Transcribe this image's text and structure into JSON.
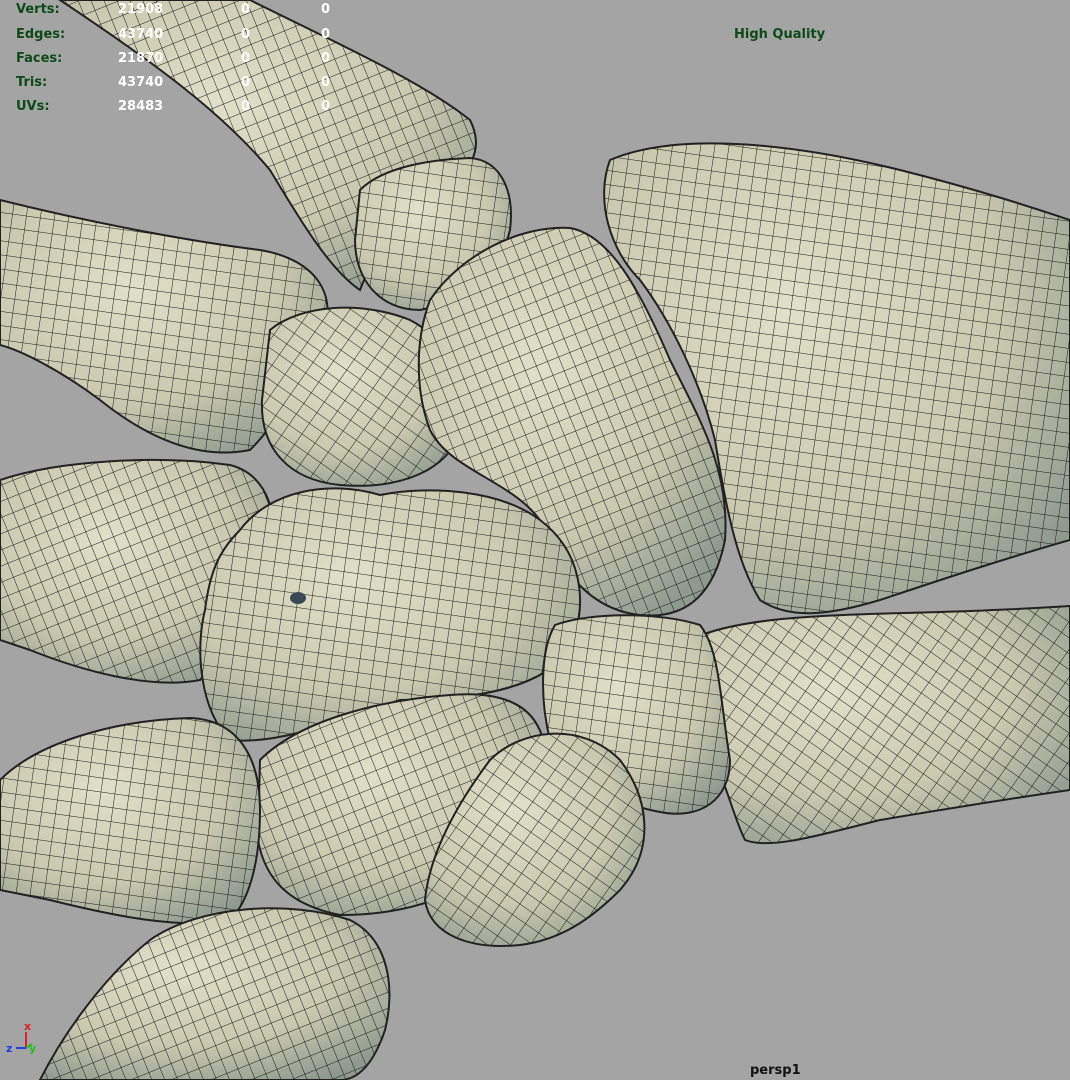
{
  "viewport": {
    "camera": "persp1",
    "quality": "High Quality"
  },
  "stats": [
    {
      "label": "Verts:",
      "value": "21908",
      "sel1": "0",
      "sel2": "0"
    },
    {
      "label": "Edges:",
      "value": "43740",
      "sel1": "0",
      "sel2": "0"
    },
    {
      "label": "Faces:",
      "value": "21870",
      "sel1": "0",
      "sel2": "0"
    },
    {
      "label": "Tris:",
      "value": "43740",
      "sel1": "0",
      "sel2": "0"
    },
    {
      "label": "UVs:",
      "value": "28483",
      "sel1": "0",
      "sel2": "0"
    }
  ],
  "axis_gizmo": {
    "x": "x",
    "y": "y",
    "z": "z"
  },
  "colors": {
    "background": "#a4a4a4",
    "bone_fill": "#d3d2b8",
    "wire": "#1a1a1a",
    "hud_label": "#0d4a18",
    "hud_value": "#ffffff",
    "axis_x": "#e02020",
    "axis_y": "#20c020",
    "axis_z": "#2040e0"
  }
}
